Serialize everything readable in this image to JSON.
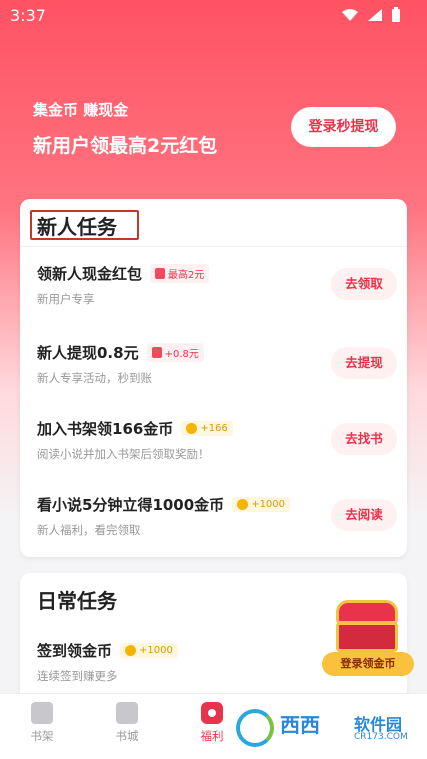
{
  "status_bar": {
    "time": "3:37"
  },
  "hero": {
    "subtitle": "集金币 赚现金",
    "title": "新用户领最高2元红包",
    "login_button": "登录秒提现"
  },
  "new_tasks": {
    "title": "新人任务",
    "items": [
      {
        "name": "领新人现金红包",
        "badge": "最高2元",
        "badge_type": "red",
        "desc": "新用户专享",
        "button": "去领取"
      },
      {
        "name": "新人提现0.8元",
        "badge": "+0.8元",
        "badge_type": "red",
        "desc": "新人专享活动，秒到账",
        "button": "去提现"
      },
      {
        "name": "加入书架领166金币",
        "badge": "+166",
        "badge_type": "gold",
        "desc": "阅读小说并加入书架后领取奖励！",
        "button": "去找书"
      },
      {
        "name": "看小说5分钟立得1000金币",
        "badge": "+1000",
        "badge_type": "gold",
        "desc": "新人福利，看完领取",
        "button": "去阅读"
      }
    ]
  },
  "daily_tasks": {
    "title": "日常任务",
    "items": [
      {
        "name": "签到领金币",
        "badge": "+1000",
        "badge_type": "gold",
        "desc": "连续签到赚更多"
      }
    ]
  },
  "floating_gift": {
    "label": "登录领金币"
  },
  "tabbar": {
    "items": [
      {
        "label": "书架",
        "icon": "bookshelf-icon"
      },
      {
        "label": "书城",
        "icon": "bookstore-icon"
      },
      {
        "label": "福利",
        "icon": "welfare-icon",
        "active": true
      }
    ]
  },
  "watermark": {
    "text1": "西西",
    "text2": "软件园",
    "text3": "CR173.COM"
  },
  "colors": {
    "accent": "#e8334a",
    "gold": "#f5b400",
    "hero_top": "#ff5263"
  }
}
